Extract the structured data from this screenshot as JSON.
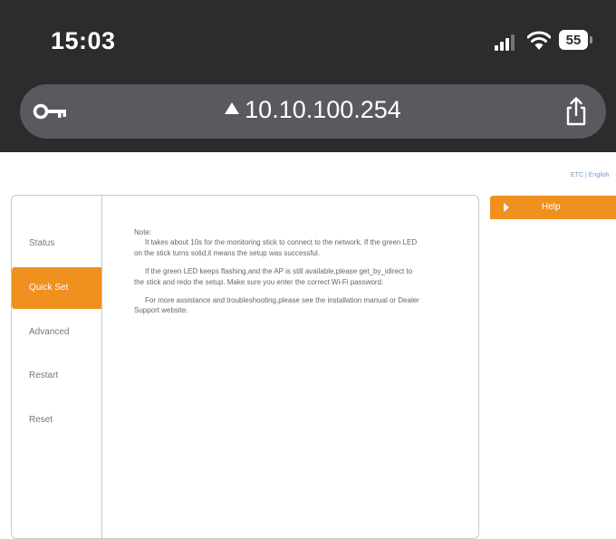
{
  "status_bar": {
    "time": "15:03",
    "battery": "55"
  },
  "address_bar": {
    "url": "10.10.100.254"
  },
  "page": {
    "language_link": "ETC | English"
  },
  "sidebar": {
    "items": [
      {
        "label": "Status",
        "active": false
      },
      {
        "label": "Quick Set",
        "active": true
      },
      {
        "label": "Advanced",
        "active": false
      },
      {
        "label": "Restart",
        "active": false
      },
      {
        "label": "Reset",
        "active": false
      }
    ]
  },
  "content": {
    "note_title": "Note:",
    "paragraphs": [
      "It takes about 10s for the monitoring stick to connect to the network. If the green LED on the stick turns solid,it means the setup was successful.",
      "If the green LED keeps flashing,and the AP is still available,please get_by_idirect to the stick and redo the setup. Make sure you enter the correct Wi-Fi password.",
      "For more assistance and troubleshooting,please see the installation manual or Dealer Support website."
    ]
  },
  "help": {
    "title": "Help"
  },
  "colors": {
    "accent": "#f0901f",
    "chrome": "#2c2c2e",
    "url_bar": "#5a5a5e"
  }
}
